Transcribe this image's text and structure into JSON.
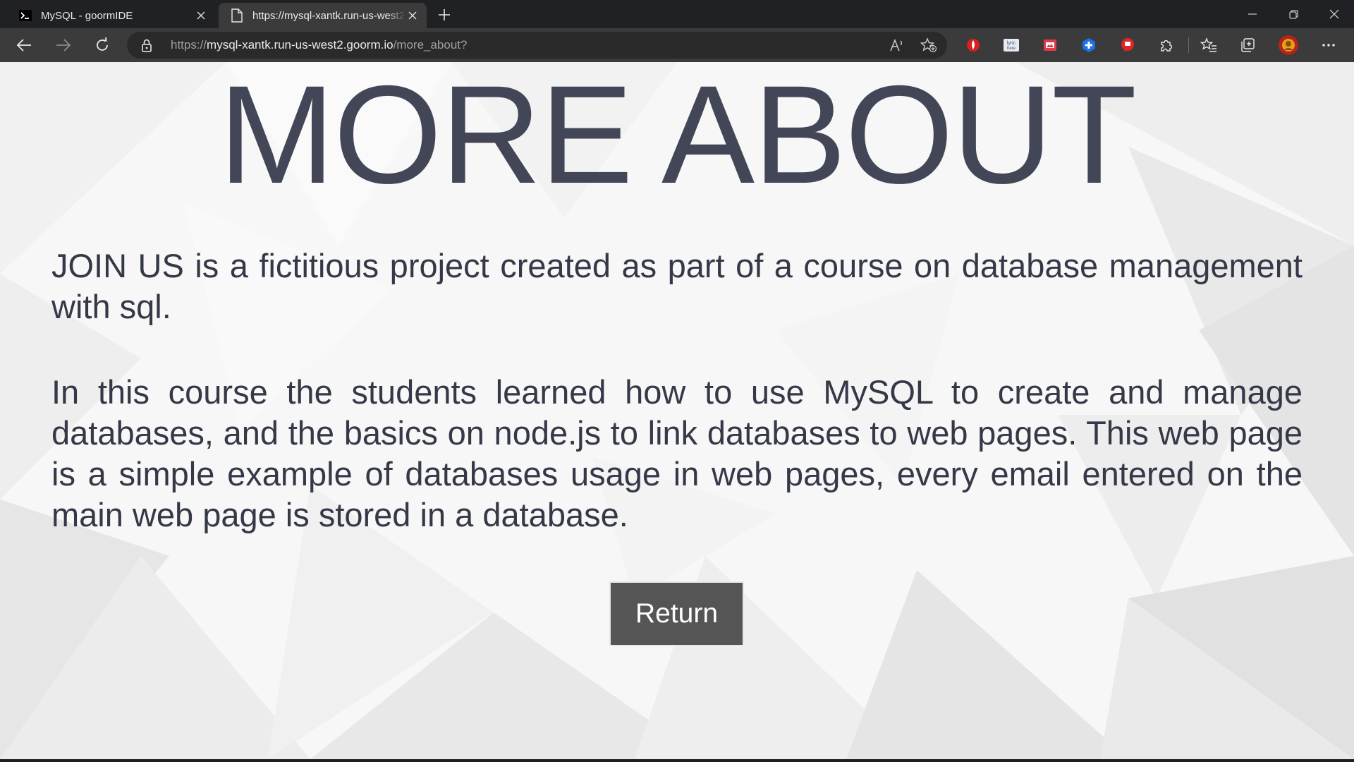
{
  "browser": {
    "tabs": [
      {
        "title": "MySQL - goormIDE",
        "icon": "terminal-icon",
        "active": false
      },
      {
        "title": "https://mysql-xantk.run-us-west2",
        "icon": "page-icon",
        "active": true
      }
    ],
    "address": {
      "scheme": "https://",
      "host": "mysql-xantk.run-us-west2.goorm.io",
      "path": "/more_about?"
    },
    "extensions": [
      "red-drop-extension-icon",
      "lyrics-here-extension-icon",
      "red-page-extension-icon",
      "blue-cross-extension-icon",
      "red-speech-extension-icon"
    ]
  },
  "page": {
    "title": "MORE ABOUT",
    "paragraphs": [
      "JOIN US is a fictitious project created as part of a course on database management with sql.",
      "In this course the students learned how to use MySQL to create and manage databases, and the basics on node.js to link databases to web pages. This web page is a simple example of databases usage in web pages, every email entered on the main web page is stored in a database."
    ],
    "return_label": "Return"
  },
  "colors": {
    "text": "#343847",
    "title": "#434656",
    "button_bg": "#555555",
    "chrome_dark": "#202124",
    "toolbar": "#3b3b3b"
  }
}
